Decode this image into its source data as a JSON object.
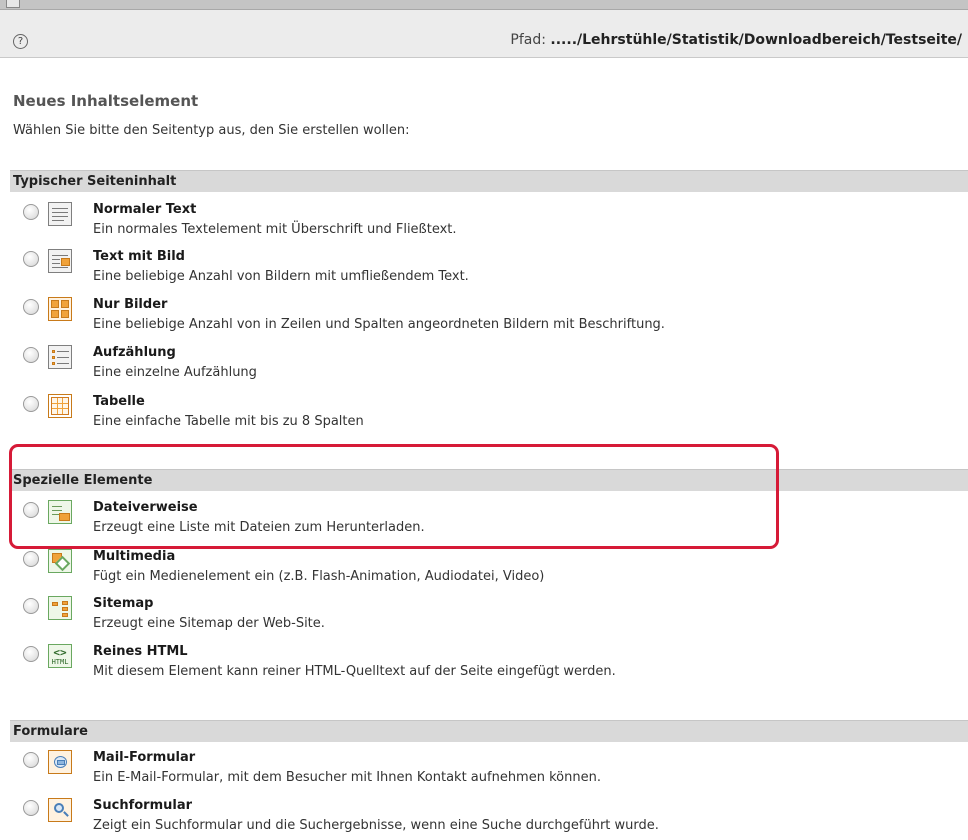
{
  "header": {
    "help_icon_glyph": "?",
    "path_label": "Pfad: ",
    "path_value": "...../Lehrstühle/Statistik/Downloadbereich/Testseite/"
  },
  "page": {
    "title": "Neues Inhaltselement",
    "subtitle": "Wählen Sie bitte den Seitentyp aus, den Sie erstellen wollen:"
  },
  "sections": {
    "typical": {
      "label": "Typischer Seiteninhalt",
      "items": [
        {
          "name": "Normaler Text",
          "desc": "Ein normales Textelement mit Überschrift und Fließtext.",
          "icon": "text-icon"
        },
        {
          "name": "Text mit Bild",
          "desc": "Eine beliebige Anzahl von Bildern mit umfließendem Text.",
          "icon": "text-with-image-icon"
        },
        {
          "name": "Nur Bilder",
          "desc": "Eine beliebige Anzahl von in Zeilen und Spalten angeordneten Bildern mit Beschriftung.",
          "icon": "images-icon"
        },
        {
          "name": "Aufzählung",
          "desc": "Eine einzelne Aufzählung",
          "icon": "bullet-list-icon"
        },
        {
          "name": "Tabelle",
          "desc": "Eine einfache Tabelle mit bis zu 8 Spalten",
          "icon": "table-icon"
        }
      ]
    },
    "special": {
      "label": "Spezielle Elemente",
      "items": [
        {
          "name": "Dateiverweise",
          "desc": "Erzeugt eine Liste mit Dateien zum Herunterladen.",
          "icon": "file-links-icon"
        },
        {
          "name": "Multimedia",
          "desc": "Fügt ein Medienelement ein (z.B. Flash-Animation, Audiodatei, Video)",
          "icon": "multimedia-icon"
        },
        {
          "name": "Sitemap",
          "desc": "Erzeugt eine Sitemap der Web-Site.",
          "icon": "sitemap-icon"
        },
        {
          "name": "Reines HTML",
          "desc": "Mit diesem Element kann reiner HTML-Quelltext auf der Seite eingefügt werden.",
          "icon": "html-icon",
          "icon_text": "HTML",
          "icon_symbol": "<>"
        }
      ]
    },
    "forms": {
      "label": "Formulare",
      "items": [
        {
          "name": "Mail-Formular",
          "desc": "Ein E-Mail-Formular, mit dem Besucher mit Ihnen Kontakt aufnehmen können.",
          "icon": "mail-form-icon"
        },
        {
          "name": "Suchformular",
          "desc": "Zeigt ein Suchformular und die Suchergebnisse, wenn eine Suche durchgeführt wurde.",
          "icon": "search-form-icon"
        }
      ]
    }
  },
  "colors": {
    "highlight": "#d61a37",
    "section_bar": "#d9d9d9",
    "icon_orange": "#f0a23a",
    "icon_green": "#6aa860"
  }
}
